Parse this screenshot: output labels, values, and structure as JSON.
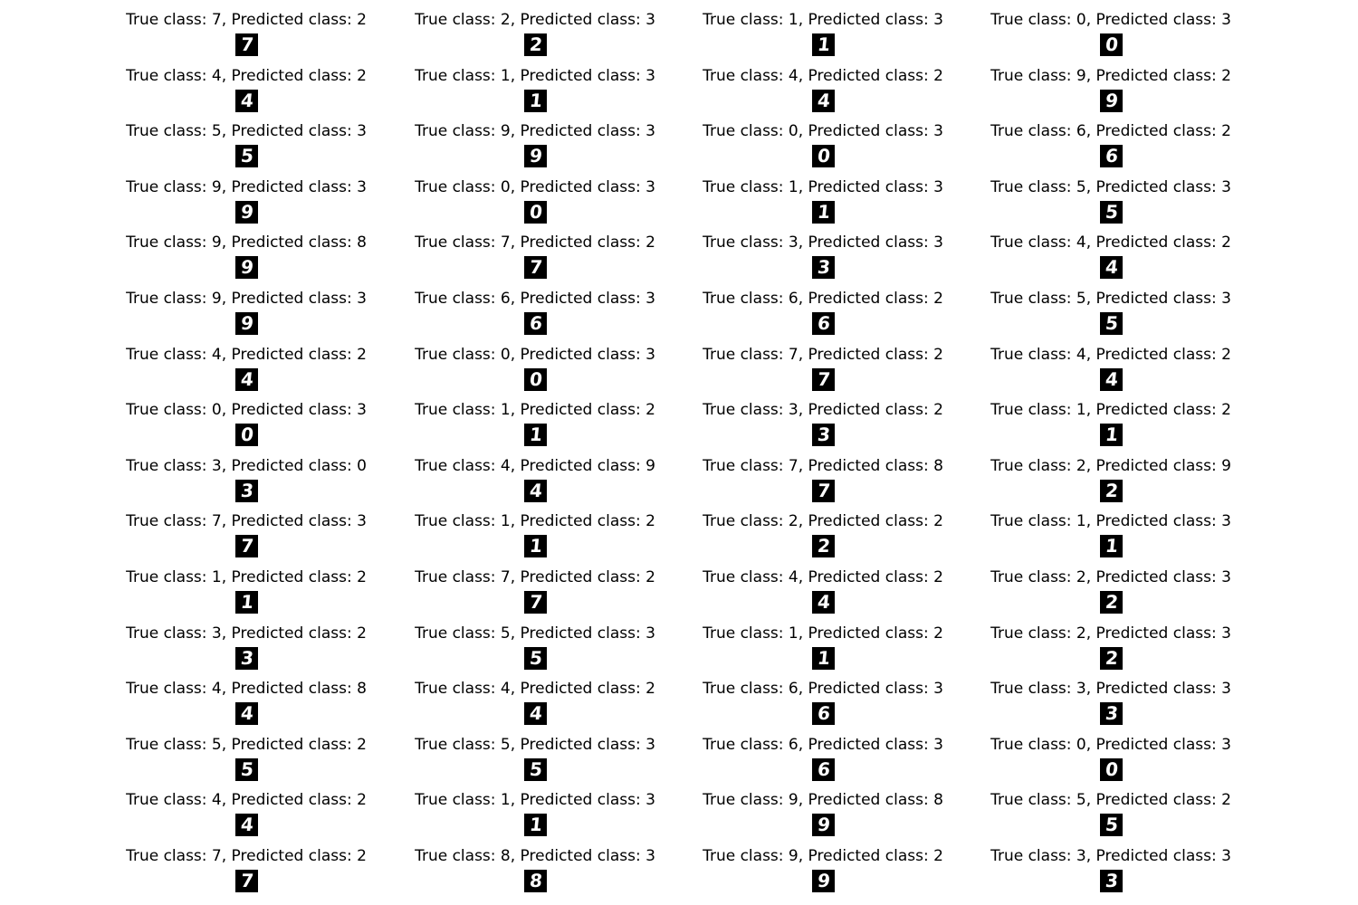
{
  "samples": [
    {
      "title": "True class: 7, Predicted class: 2",
      "digit": "7"
    },
    {
      "title": "True class: 2, Predicted class: 3",
      "digit": "2"
    },
    {
      "title": "True class: 1, Predicted class: 3",
      "digit": "1"
    },
    {
      "title": "True class: 0, Predicted class: 3",
      "digit": "0"
    },
    {
      "title": "True class: 4, Predicted class: 2",
      "digit": "4"
    },
    {
      "title": "True class: 1, Predicted class: 3",
      "digit": "1"
    },
    {
      "title": "True class: 4, Predicted class: 2",
      "digit": "4"
    },
    {
      "title": "True class: 9, Predicted class: 2",
      "digit": "9"
    },
    {
      "title": "True class: 5, Predicted class: 3",
      "digit": "5"
    },
    {
      "title": "True class: 9, Predicted class: 3",
      "digit": "9"
    },
    {
      "title": "True class: 0, Predicted class: 3",
      "digit": "0"
    },
    {
      "title": "True class: 6, Predicted class: 2",
      "digit": "6"
    },
    {
      "title": "True class: 9, Predicted class: 3",
      "digit": "9"
    },
    {
      "title": "True class: 0, Predicted class: 3",
      "digit": "0"
    },
    {
      "title": "True class: 1, Predicted class: 3",
      "digit": "1"
    },
    {
      "title": "True class: 5, Predicted class: 3",
      "digit": "5"
    },
    {
      "title": "True class: 9, Predicted class: 8",
      "digit": "9"
    },
    {
      "title": "True class: 7, Predicted class: 2",
      "digit": "7"
    },
    {
      "title": "True class: 3, Predicted class: 3",
      "digit": "3"
    },
    {
      "title": "True class: 4, Predicted class: 2",
      "digit": "4"
    },
    {
      "title": "True class: 9, Predicted class: 3",
      "digit": "9"
    },
    {
      "title": "True class: 6, Predicted class: 3",
      "digit": "6"
    },
    {
      "title": "True class: 6, Predicted class: 2",
      "digit": "6"
    },
    {
      "title": "True class: 5, Predicted class: 3",
      "digit": "5"
    },
    {
      "title": "True class: 4, Predicted class: 2",
      "digit": "4"
    },
    {
      "title": "True class: 0, Predicted class: 3",
      "digit": "0"
    },
    {
      "title": "True class: 7, Predicted class: 2",
      "digit": "7"
    },
    {
      "title": "True class: 4, Predicted class: 2",
      "digit": "4"
    },
    {
      "title": "True class: 0, Predicted class: 3",
      "digit": "0"
    },
    {
      "title": "True class: 1, Predicted class: 2",
      "digit": "1"
    },
    {
      "title": "True class: 3, Predicted class: 2",
      "digit": "3"
    },
    {
      "title": "True class: 1, Predicted class: 2",
      "digit": "1"
    },
    {
      "title": "True class: 3, Predicted class: 0",
      "digit": "3"
    },
    {
      "title": "True class: 4, Predicted class: 9",
      "digit": "4"
    },
    {
      "title": "True class: 7, Predicted class: 8",
      "digit": "7"
    },
    {
      "title": "True class: 2, Predicted class: 9",
      "digit": "2"
    },
    {
      "title": "True class: 7, Predicted class: 3",
      "digit": "7"
    },
    {
      "title": "True class: 1, Predicted class: 2",
      "digit": "1"
    },
    {
      "title": "True class: 2, Predicted class: 2",
      "digit": "2"
    },
    {
      "title": "True class: 1, Predicted class: 3",
      "digit": "1"
    },
    {
      "title": "True class: 1, Predicted class: 2",
      "digit": "1"
    },
    {
      "title": "True class: 7, Predicted class: 2",
      "digit": "7"
    },
    {
      "title": "True class: 4, Predicted class: 2",
      "digit": "4"
    },
    {
      "title": "True class: 2, Predicted class: 3",
      "digit": "2"
    },
    {
      "title": "True class: 3, Predicted class: 2",
      "digit": "3"
    },
    {
      "title": "True class: 5, Predicted class: 3",
      "digit": "5"
    },
    {
      "title": "True class: 1, Predicted class: 2",
      "digit": "1"
    },
    {
      "title": "True class: 2, Predicted class: 3",
      "digit": "2"
    },
    {
      "title": "True class: 4, Predicted class: 8",
      "digit": "4"
    },
    {
      "title": "True class: 4, Predicted class: 2",
      "digit": "4"
    },
    {
      "title": "True class: 6, Predicted class: 3",
      "digit": "6"
    },
    {
      "title": "True class: 3, Predicted class: 3",
      "digit": "3"
    },
    {
      "title": "True class: 5, Predicted class: 2",
      "digit": "5"
    },
    {
      "title": "True class: 5, Predicted class: 3",
      "digit": "5"
    },
    {
      "title": "True class: 6, Predicted class: 3",
      "digit": "6"
    },
    {
      "title": "True class: 0, Predicted class: 3",
      "digit": "0"
    },
    {
      "title": "True class: 4, Predicted class: 2",
      "digit": "4"
    },
    {
      "title": "True class: 1, Predicted class: 3",
      "digit": "1"
    },
    {
      "title": "True class: 9, Predicted class: 8",
      "digit": "9"
    },
    {
      "title": "True class: 5, Predicted class: 2",
      "digit": "5"
    },
    {
      "title": "True class: 7, Predicted class: 2",
      "digit": "7"
    },
    {
      "title": "True class: 8, Predicted class: 3",
      "digit": "8"
    },
    {
      "title": "True class: 9, Predicted class: 2",
      "digit": "9"
    },
    {
      "title": "True class: 3, Predicted class: 3",
      "digit": "3"
    }
  ]
}
